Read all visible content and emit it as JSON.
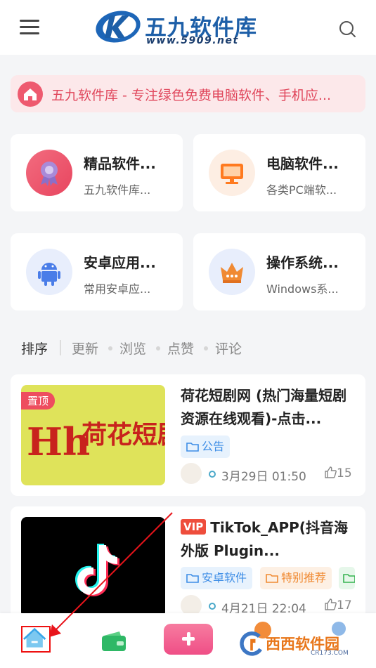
{
  "header": {
    "logo_title": "五九软件库",
    "logo_url": "www.5909.net"
  },
  "notice": {
    "text": "五九软件库 - 专注绿色免费电脑软件、手机应..."
  },
  "categories": [
    {
      "title": "精品软件...",
      "subtitle": "五九软件库...",
      "icon": "award-icon",
      "color": "#ee4f6b"
    },
    {
      "title": "电脑软件...",
      "subtitle": "各类PC端软...",
      "icon": "monitor-icon",
      "color": "#ff8a33"
    },
    {
      "title": "安卓应用...",
      "subtitle": "常用安卓应...",
      "icon": "android-icon",
      "color": "#4a7de8"
    },
    {
      "title": "操作系统...",
      "subtitle": "Windows系...",
      "icon": "crown-icon",
      "color": "#f08a33"
    }
  ],
  "sort": {
    "label": "排序",
    "options": [
      "更新",
      "浏览",
      "点赞",
      "评论"
    ]
  },
  "posts": [
    {
      "badge": "置顶",
      "thumb_text": "荷花短剧",
      "title": "荷花短剧网 (热门海量短剧资源在线观看)-点击...",
      "tags": [
        "公告"
      ],
      "date": "3月29日 01:50",
      "likes": "15"
    },
    {
      "vip": "VIP",
      "title": "TikTok_APP(抖音海外版 Plugin...",
      "tags": [
        "安卓软件",
        "特别推荐"
      ],
      "date": "4月21日 22:04",
      "likes": "17"
    }
  ],
  "watermark": {
    "text": "西西软件园",
    "sub": "CR173.COM"
  },
  "colors": {
    "accent": "#ee4d5f",
    "brand": "#1d5fa8",
    "tag_blue": "#3d8de6",
    "tag_orange": "#f08a32"
  }
}
